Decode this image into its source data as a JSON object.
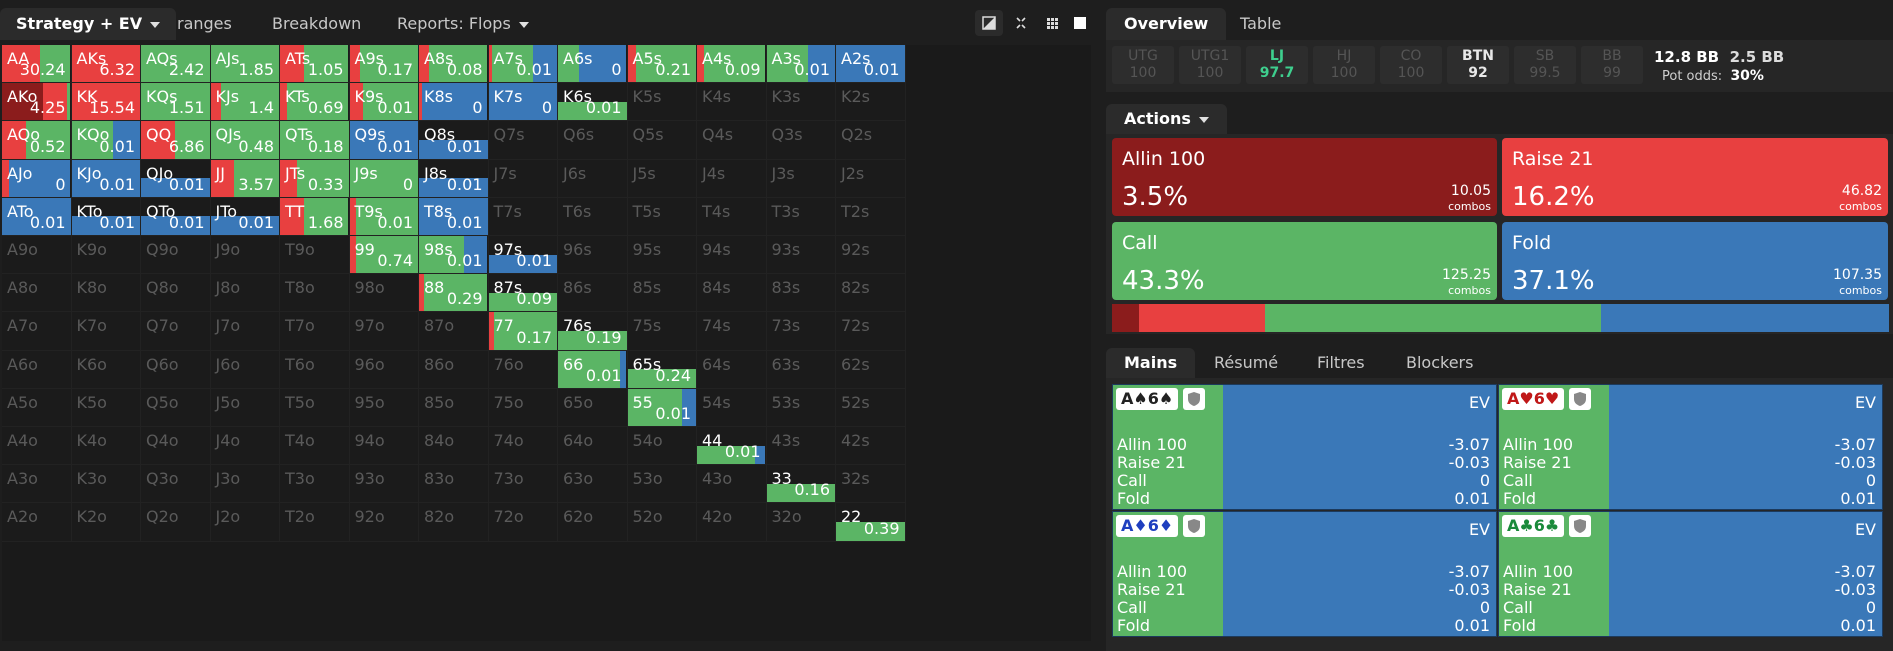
{
  "topbar": {
    "tabs": [
      "Strategy + EV",
      "ranges",
      "Breakdown",
      "Reports: Flops"
    ]
  },
  "colors": {
    "allin": "#8b1c1c",
    "raise": "#e84040",
    "call": "#5bb565",
    "fold": "#3a78b8",
    "empty": "#1b1b1b",
    "accent_lj": "#3ecf8e"
  },
  "range_grid": {
    "cells": [
      [
        "AA",
        "30.24",
        "r:0.55,c:0.45"
      ],
      [
        "AKs",
        "6.32",
        "r:1"
      ],
      [
        "AQs",
        "2.42",
        "c:1"
      ],
      [
        "AJs",
        "1.85",
        "c:1"
      ],
      [
        "ATs",
        "1.05",
        "r:0.35,c:0.65"
      ],
      [
        "A9s",
        "0.17",
        "r:0.15,c:0.85"
      ],
      [
        "A8s",
        "0.08",
        "r:0.15,c:0.85"
      ],
      [
        "A7s",
        "0.01",
        "r:0.05,c:0.6,f:0.35"
      ],
      [
        "A6s",
        "0",
        "c:0.3,f:0.7"
      ],
      [
        "A5s",
        "0.21",
        "r:0.12,c:0.88"
      ],
      [
        "A4s",
        "0.09",
        "r:0.1,c:0.9"
      ],
      [
        "A3s",
        "0.01",
        "c:0.6,f:0.4"
      ],
      [
        "A2s",
        "0.01",
        "f:1"
      ],
      [
        "AKo",
        "4.25",
        "a:0.6,r:0.35,c:0.05"
      ],
      [
        "KK",
        "15.54",
        "r:1"
      ],
      [
        "KQs",
        "1.51",
        "c:1"
      ],
      [
        "KJs",
        "1.4",
        "r:0.15,c:0.85"
      ],
      [
        "KTs",
        "0.69",
        "r:0.1,c:0.9"
      ],
      [
        "K9s",
        "0.01",
        "r:0.2,c:0.8"
      ],
      [
        "K8s",
        "0",
        "r:0.05,f:0.95"
      ],
      [
        "K7s",
        "0",
        "f:1"
      ],
      [
        "K6s",
        "0.01",
        "c:1,h"
      ],
      [
        "K5s",
        "",
        ""
      ],
      [
        "K4s",
        "",
        ""
      ],
      [
        "K3s",
        "",
        ""
      ],
      [
        "K2s",
        "",
        ""
      ],
      [
        "AQo",
        "0.52",
        "r:0.35,c:0.65"
      ],
      [
        "KQo",
        "0.01",
        "c:0.6,f:0.4"
      ],
      [
        "QQ",
        "6.86",
        "r:0.5,c:0.5"
      ],
      [
        "QJs",
        "0.48",
        "c:1"
      ],
      [
        "QTs",
        "0.18",
        "c:1"
      ],
      [
        "Q9s",
        "0.01",
        "f:1"
      ],
      [
        "Q8s",
        "0.01",
        "f:1,h"
      ],
      [
        "Q7s",
        "",
        ""
      ],
      [
        "Q6s",
        "",
        ""
      ],
      [
        "Q5s",
        "",
        ""
      ],
      [
        "Q4s",
        "",
        ""
      ],
      [
        "Q3s",
        "",
        ""
      ],
      [
        "Q2s",
        "",
        ""
      ],
      [
        "AJo",
        "0",
        "r:0.1,f:0.9"
      ],
      [
        "KJo",
        "0.01",
        "f:1"
      ],
      [
        "QJo",
        "0.01",
        "f:1,h"
      ],
      [
        "JJ",
        "3.57",
        "r:0.35,c:0.65"
      ],
      [
        "JTs",
        "0.33",
        "r:0.25,c:0.75"
      ],
      [
        "J9s",
        "0",
        "c:1"
      ],
      [
        "J8s",
        "0.01",
        "f:1,h"
      ],
      [
        "J7s",
        "",
        ""
      ],
      [
        "J6s",
        "",
        ""
      ],
      [
        "J5s",
        "",
        ""
      ],
      [
        "J4s",
        "",
        ""
      ],
      [
        "J3s",
        "",
        ""
      ],
      [
        "J2s",
        "",
        ""
      ],
      [
        "ATo",
        "0.01",
        "f:1"
      ],
      [
        "KTo",
        "0.01",
        "f:1,h"
      ],
      [
        "QTo",
        "0.01",
        "f:1,h"
      ],
      [
        "JTo",
        "0.01",
        "f:1,h"
      ],
      [
        "TT",
        "1.68",
        "r:0.35,c:0.65"
      ],
      [
        "T9s",
        "0.01",
        "r:0.1,c:0.9"
      ],
      [
        "T8s",
        "0.01",
        "f:1"
      ],
      [
        "T7s",
        "",
        ""
      ],
      [
        "T6s",
        "",
        ""
      ],
      [
        "T5s",
        "",
        ""
      ],
      [
        "T4s",
        "",
        ""
      ],
      [
        "T3s",
        "",
        ""
      ],
      [
        "T2s",
        "",
        ""
      ],
      [
        "A9o",
        "",
        ""
      ],
      [
        "K9o",
        "",
        ""
      ],
      [
        "Q9o",
        "",
        ""
      ],
      [
        "J9o",
        "",
        ""
      ],
      [
        "T9o",
        "",
        ""
      ],
      [
        "99",
        "0.74",
        "r:0.1,c:0.9"
      ],
      [
        "98s",
        "0.01",
        "c:0.65,f:0.35"
      ],
      [
        "97s",
        "0.01",
        "f:1,h"
      ],
      [
        "96s",
        "",
        ""
      ],
      [
        "95s",
        "",
        ""
      ],
      [
        "94s",
        "",
        ""
      ],
      [
        "93s",
        "",
        ""
      ],
      [
        "92s",
        "",
        ""
      ],
      [
        "A8o",
        "",
        ""
      ],
      [
        "K8o",
        "",
        ""
      ],
      [
        "Q8o",
        "",
        ""
      ],
      [
        "J8o",
        "",
        ""
      ],
      [
        "T8o",
        "",
        ""
      ],
      [
        "98o",
        "",
        ""
      ],
      [
        "88",
        "0.29",
        "r:0.08,c:0.92"
      ],
      [
        "87s",
        "0.09",
        "c:1,h"
      ],
      [
        "86s",
        "",
        ""
      ],
      [
        "85s",
        "",
        ""
      ],
      [
        "84s",
        "",
        ""
      ],
      [
        "83s",
        "",
        ""
      ],
      [
        "82s",
        "",
        ""
      ],
      [
        "A7o",
        "",
        ""
      ],
      [
        "K7o",
        "",
        ""
      ],
      [
        "Q7o",
        "",
        ""
      ],
      [
        "J7o",
        "",
        ""
      ],
      [
        "T7o",
        "",
        ""
      ],
      [
        "97o",
        "",
        ""
      ],
      [
        "87o",
        "",
        ""
      ],
      [
        "77",
        "0.17",
        "r:0.08,c:0.92"
      ],
      [
        "76s",
        "0.19",
        "c:1,h"
      ],
      [
        "75s",
        "",
        ""
      ],
      [
        "74s",
        "",
        ""
      ],
      [
        "73s",
        "",
        ""
      ],
      [
        "72s",
        "",
        ""
      ],
      [
        "A6o",
        "",
        ""
      ],
      [
        "K6o",
        "",
        ""
      ],
      [
        "Q6o",
        "",
        ""
      ],
      [
        "J6o",
        "",
        ""
      ],
      [
        "T6o",
        "",
        ""
      ],
      [
        "96o",
        "",
        ""
      ],
      [
        "86o",
        "",
        ""
      ],
      [
        "76o",
        "",
        ""
      ],
      [
        "66",
        "0.01",
        "c:0.9,f:0.1"
      ],
      [
        "65s",
        "0.24",
        "c:1,h"
      ],
      [
        "64s",
        "",
        ""
      ],
      [
        "63s",
        "",
        ""
      ],
      [
        "62s",
        "",
        ""
      ],
      [
        "A5o",
        "",
        ""
      ],
      [
        "K5o",
        "",
        ""
      ],
      [
        "Q5o",
        "",
        ""
      ],
      [
        "J5o",
        "",
        ""
      ],
      [
        "T5o",
        "",
        ""
      ],
      [
        "95o",
        "",
        ""
      ],
      [
        "85o",
        "",
        ""
      ],
      [
        "75o",
        "",
        ""
      ],
      [
        "65o",
        "",
        ""
      ],
      [
        "55",
        "0.01",
        "c:0.8,f:0.2"
      ],
      [
        "54s",
        "",
        ""
      ],
      [
        "53s",
        "",
        ""
      ],
      [
        "52s",
        "",
        ""
      ],
      [
        "A4o",
        "",
        ""
      ],
      [
        "K4o",
        "",
        ""
      ],
      [
        "Q4o",
        "",
        ""
      ],
      [
        "J4o",
        "",
        ""
      ],
      [
        "T4o",
        "",
        ""
      ],
      [
        "94o",
        "",
        ""
      ],
      [
        "84o",
        "",
        ""
      ],
      [
        "74o",
        "",
        ""
      ],
      [
        "64o",
        "",
        ""
      ],
      [
        "54o",
        "",
        ""
      ],
      [
        "44",
        "0.01",
        "c:0.85,f:0.15,h"
      ],
      [
        "43s",
        "",
        ""
      ],
      [
        "42s",
        "",
        ""
      ],
      [
        "A3o",
        "",
        ""
      ],
      [
        "K3o",
        "",
        ""
      ],
      [
        "Q3o",
        "",
        ""
      ],
      [
        "J3o",
        "",
        ""
      ],
      [
        "T3o",
        "",
        ""
      ],
      [
        "93o",
        "",
        ""
      ],
      [
        "83o",
        "",
        ""
      ],
      [
        "73o",
        "",
        ""
      ],
      [
        "63o",
        "",
        ""
      ],
      [
        "53o",
        "",
        ""
      ],
      [
        "43o",
        "",
        ""
      ],
      [
        "33",
        "0.16",
        "c:1,h"
      ],
      [
        "32s",
        "",
        ""
      ],
      [
        "A2o",
        "",
        ""
      ],
      [
        "K2o",
        "",
        ""
      ],
      [
        "Q2o",
        "",
        ""
      ],
      [
        "J2o",
        "",
        ""
      ],
      [
        "T2o",
        "",
        ""
      ],
      [
        "92o",
        "",
        ""
      ],
      [
        "82o",
        "",
        ""
      ],
      [
        "72o",
        "",
        ""
      ],
      [
        "62o",
        "",
        ""
      ],
      [
        "52o",
        "",
        ""
      ],
      [
        "42o",
        "",
        ""
      ],
      [
        "32o",
        "",
        ""
      ],
      [
        "22",
        "0.39",
        "c:1,h"
      ]
    ]
  },
  "right": {
    "tabs": [
      "Overview",
      "Table"
    ],
    "positions": [
      {
        "name": "UTG",
        "stack": "100"
      },
      {
        "name": "UTG1",
        "stack": "100"
      },
      {
        "name": "LJ",
        "stack": "97.7"
      },
      {
        "name": "HJ",
        "stack": "100"
      },
      {
        "name": "CO",
        "stack": "100"
      },
      {
        "name": "BTN",
        "stack": "92"
      },
      {
        "name": "SB",
        "stack": "99.5"
      },
      {
        "name": "BB",
        "stack": "99"
      }
    ],
    "pot": {
      "bb1": "12.8 BB",
      "bb2": "2.5 BB",
      "odds_label": "Pot odds:",
      "odds_value": "30%"
    },
    "actions_label": "Actions",
    "actions": [
      {
        "name": "Allin 100",
        "pct": "3.5%",
        "combos": "10.05",
        "unit": "combos",
        "fraction": 0.035
      },
      {
        "name": "Raise 21",
        "pct": "16.2%",
        "combos": "46.82",
        "unit": "combos",
        "fraction": 0.162
      },
      {
        "name": "Call",
        "pct": "43.3%",
        "combos": "125.25",
        "unit": "combos",
        "fraction": 0.433
      },
      {
        "name": "Fold",
        "pct": "37.1%",
        "combos": "107.35",
        "unit": "combos",
        "fraction": 0.371
      }
    ],
    "bottom_tabs": [
      "Mains",
      "Résumé",
      "Filtres",
      "Blockers"
    ],
    "combos": [
      {
        "card": "A♠6♠",
        "suit_color": "#222",
        "ev_label": "EV",
        "rows": [
          [
            "Allin 100",
            "-3.07"
          ],
          [
            "Raise 21",
            "-0.03"
          ],
          [
            "Call",
            "0"
          ],
          [
            "Fold",
            "0.01"
          ]
        ]
      },
      {
        "card": "A♥6♥",
        "suit_color": "#c01818",
        "ev_label": "EV",
        "rows": [
          [
            "Allin 100",
            "-3.07"
          ],
          [
            "Raise 21",
            "-0.03"
          ],
          [
            "Call",
            "0"
          ],
          [
            "Fold",
            "0.01"
          ]
        ]
      },
      {
        "card": "A♦6♦",
        "suit_color": "#1f3fbf",
        "ev_label": "EV",
        "rows": [
          [
            "Allin 100",
            "-3.07"
          ],
          [
            "Raise 21",
            "-0.03"
          ],
          [
            "Call",
            "0"
          ],
          [
            "Fold",
            "0.01"
          ]
        ]
      },
      {
        "card": "A♣6♣",
        "suit_color": "#1a8a3a",
        "ev_label": "EV",
        "rows": [
          [
            "Allin 100",
            "-3.07"
          ],
          [
            "Raise 21",
            "-0.03"
          ],
          [
            "Call",
            "0"
          ],
          [
            "Fold",
            "0.01"
          ]
        ]
      }
    ]
  }
}
